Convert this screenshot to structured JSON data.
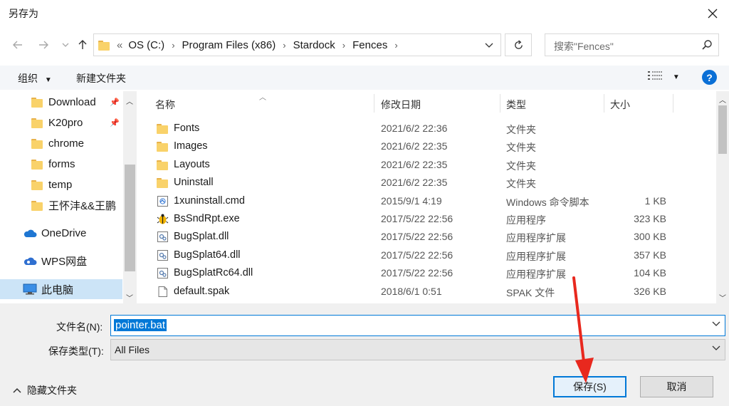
{
  "window": {
    "title": "另存为"
  },
  "address": {
    "overflow": "«",
    "crumbs": [
      "OS (C:)",
      "Program Files (x86)",
      "Stardock",
      "Fences"
    ]
  },
  "search": {
    "placeholder": "搜索\"Fences\""
  },
  "toolbar": {
    "organize": "组织",
    "new_folder": "新建文件夹",
    "help": "?"
  },
  "nav": {
    "items": [
      {
        "label": "Download",
        "pinned": true
      },
      {
        "label": "K20pro",
        "pinned": true
      },
      {
        "label": "chrome",
        "pinned": false
      },
      {
        "label": "forms",
        "pinned": false
      },
      {
        "label": "temp",
        "pinned": false
      },
      {
        "label": "王怀沣&&王鹏",
        "pinned": false
      },
      {
        "label": "OneDrive"
      },
      {
        "label": "WPS网盘"
      },
      {
        "label": "此电脑"
      }
    ]
  },
  "columns": {
    "name": "名称",
    "date": "修改日期",
    "type": "类型",
    "size": "大小"
  },
  "files": [
    {
      "name": "Fonts",
      "date": "2021/6/2 22:36",
      "type": "文件夹",
      "size": "",
      "icon": "folder-icon"
    },
    {
      "name": "Images",
      "date": "2021/6/2 22:35",
      "type": "文件夹",
      "size": "",
      "icon": "folder-icon"
    },
    {
      "name": "Layouts",
      "date": "2021/6/2 22:35",
      "type": "文件夹",
      "size": "",
      "icon": "folder-icon"
    },
    {
      "name": "Uninstall",
      "date": "2021/6/2 22:35",
      "type": "文件夹",
      "size": "",
      "icon": "folder-icon"
    },
    {
      "name": "1xuninstall.cmd",
      "date": "2015/9/1 4:19",
      "type": "Windows 命令脚本",
      "size": "1 KB",
      "icon": "script-icon"
    },
    {
      "name": "BsSndRpt.exe",
      "date": "2017/5/22 22:56",
      "type": "应用程序",
      "size": "323 KB",
      "icon": "bug-app-icon"
    },
    {
      "name": "BugSplat.dll",
      "date": "2017/5/22 22:56",
      "type": "应用程序扩展",
      "size": "300 KB",
      "icon": "dll-icon"
    },
    {
      "name": "BugSplat64.dll",
      "date": "2017/5/22 22:56",
      "type": "应用程序扩展",
      "size": "357 KB",
      "icon": "dll-icon"
    },
    {
      "name": "BugSplatRc64.dll",
      "date": "2017/5/22 22:56",
      "type": "应用程序扩展",
      "size": "104 KB",
      "icon": "dll-icon"
    },
    {
      "name": "default.spak",
      "date": "2018/6/1 0:51",
      "type": "SPAK 文件",
      "size": "326 KB",
      "icon": "file-icon"
    }
  ],
  "form": {
    "filename_label": "文件名(N):",
    "filename_value": "pointer.bat",
    "filetype_label": "保存类型(T):",
    "filetype_value": "All Files"
  },
  "footer": {
    "hide_folders": "隐藏文件夹",
    "save": "保存(S)",
    "cancel": "取消"
  },
  "colors": {
    "accent": "#0078d7",
    "selection": "#cce4f7",
    "annotation_arrow": "#e8281e"
  }
}
